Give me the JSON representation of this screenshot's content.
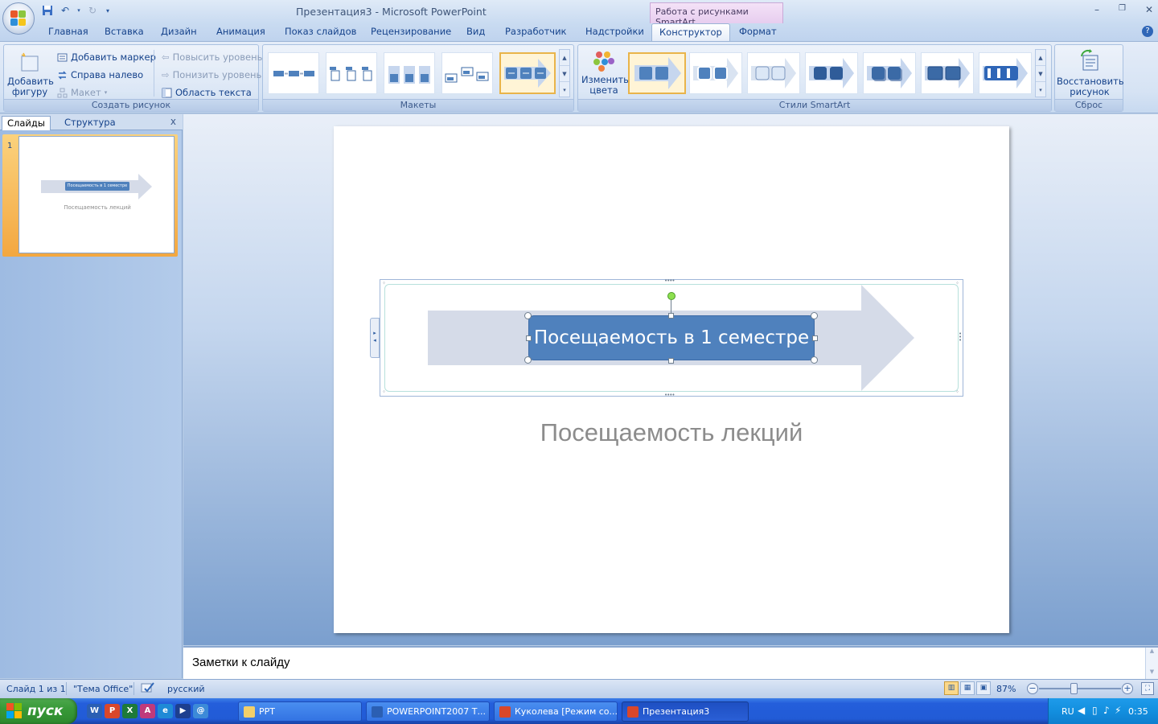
{
  "window": {
    "title": "Презентация3 - Microsoft PowerPoint",
    "context_tab_header": "Работа с рисунками SmartArt",
    "controls": [
      "–",
      "❐",
      "✕"
    ]
  },
  "ribbon_tabs": [
    "Главная",
    "Вставка",
    "Дизайн",
    "Анимация",
    "Показ слайдов",
    "Рецензирование",
    "Вид",
    "Разработчик",
    "Надстройки",
    "Конструктор",
    "Формат"
  ],
  "active_tab": "Конструктор",
  "groups": {
    "create": {
      "label": "Создать рисунок",
      "add_shape": "Добавить фигуру",
      "add_bullet": "Добавить маркер",
      "right_to_left": "Справа налево",
      "layout": "Макет",
      "promote": "Повысить уровень",
      "demote": "Понизить уровень",
      "text_pane": "Область текста"
    },
    "layouts": {
      "label": "Макеты"
    },
    "styles": {
      "label": "Стили SmartArt",
      "change_colors": "Изменить цвета"
    },
    "reset": {
      "label": "Сброс",
      "reset_graphic": "Восстановить рисунок"
    }
  },
  "left_pane": {
    "tabs": [
      "Слайды",
      "Структура"
    ],
    "close": "x",
    "slide_number": "1",
    "thumb_box_text": "Посещаемость в 1 семестре",
    "thumb_subtitle": "Посещаемость лекций"
  },
  "slide": {
    "smartart_text": "Посещаемость в 1 семестре",
    "subtitle": "Посещаемость лекций"
  },
  "notes": {
    "placeholder": "Заметки к слайду"
  },
  "status": {
    "slide_info": "Слайд 1 из 1",
    "theme": "\"Тема Office\"",
    "language": "русский",
    "zoom": "87%"
  },
  "taskbar": {
    "start": "пуск",
    "tasks": [
      "PPT",
      "POWERPOINT2007 Т...",
      "Куколева [Режим со...",
      "Презентация3"
    ],
    "tray_lang": "RU",
    "clock": "0:35"
  },
  "colors": {
    "accent_blue": "#4f81bd",
    "arrow_fill": "#d5dbe8",
    "selection_gold": "#e9b44a"
  }
}
